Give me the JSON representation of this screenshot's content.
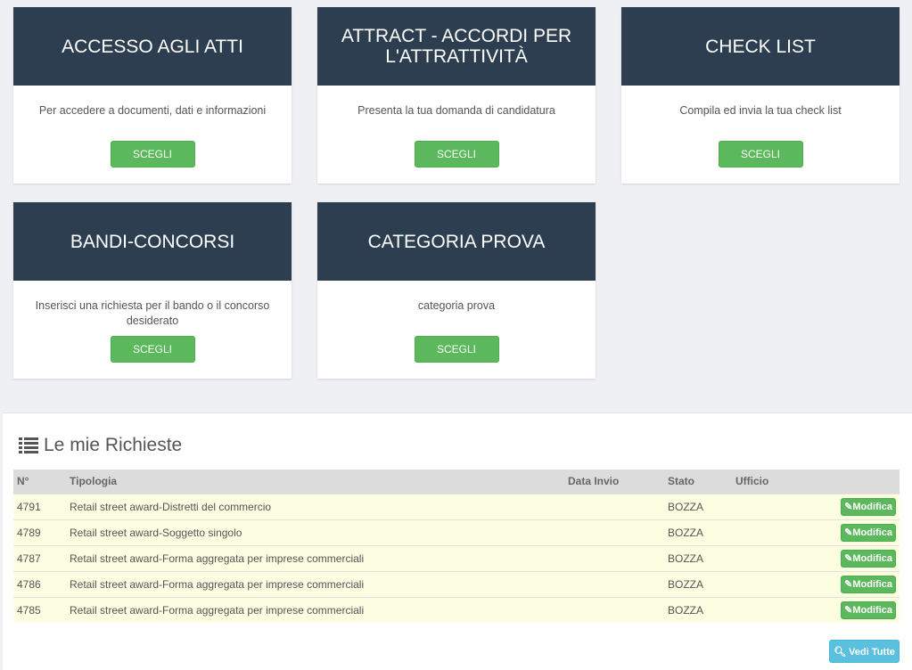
{
  "categories": [
    {
      "title": "ACCESSO AGLI ATTI",
      "description": "Per accedere a documenti, dati e informazioni",
      "button": "SCEGLI"
    },
    {
      "title": "ATTRACT - ACCORDI PER L'ATTRATTIVITÀ",
      "description": "Presenta la tua domanda di candidatura",
      "button": "SCEGLI"
    },
    {
      "title": "CHECK LIST",
      "description": "Compila ed invia la tua check list",
      "button": "SCEGLI"
    },
    {
      "title": "BANDI-CONCORSI",
      "description": "Inserisci una richiesta per il bando o il concorso desiderato",
      "button": "SCEGLI"
    },
    {
      "title": "CATEGORIA PROVA",
      "description": "categoria prova",
      "button": "SCEGLI"
    }
  ],
  "requests": {
    "title": "Le mie Richieste",
    "icon": "list-icon",
    "columns": [
      "N°",
      "Tipologia",
      "Data Invio",
      "Stato",
      "Ufficio",
      ""
    ],
    "rows": [
      {
        "n": "4791",
        "tipologia": "Retail street award-Distretti del commercio",
        "data": "",
        "stato": "BOZZA",
        "ufficio": "",
        "action": "Modifica"
      },
      {
        "n": "4789",
        "tipologia": "Retail street award-Soggetto singolo",
        "data": "",
        "stato": "BOZZA",
        "ufficio": "",
        "action": "Modifica"
      },
      {
        "n": "4787",
        "tipologia": "Retail street award-Forma aggregata per imprese commerciali",
        "data": "",
        "stato": "BOZZA",
        "ufficio": "",
        "action": "Modifica"
      },
      {
        "n": "4786",
        "tipologia": "Retail street award-Forma aggregata per imprese commerciali",
        "data": "",
        "stato": "BOZZA",
        "ufficio": "",
        "action": "Modifica"
      },
      {
        "n": "4785",
        "tipologia": "Retail street award-Forma aggregata per imprese commerciali",
        "data": "",
        "stato": "BOZZA",
        "ufficio": "",
        "action": "Modifica"
      }
    ],
    "view_all": "Vedi Tutte"
  },
  "colors": {
    "card_header": "#2c3e50",
    "success": "#5cb85c",
    "info": "#5bc0de",
    "row_bg": "#fcfde1"
  }
}
